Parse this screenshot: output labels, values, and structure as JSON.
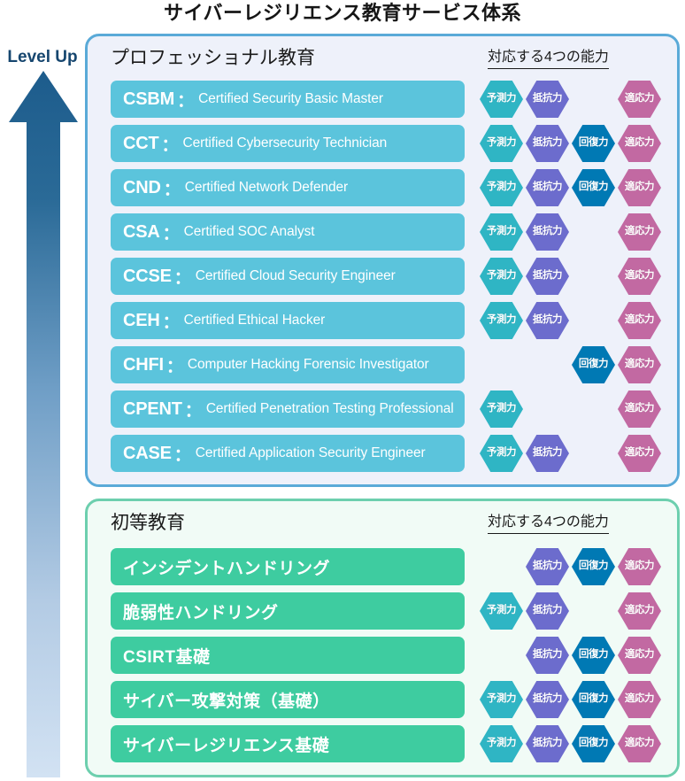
{
  "title": "サイバーレジリエンス教育サービス体系",
  "level_up": {
    "label": "Level Up",
    "arrow_icon": "up-arrow-icon",
    "gradient_from": "#1d5c8c",
    "gradient_to": "#cfe0f2"
  },
  "capability_legend": {
    "yosoku": {
      "key": "yosoku",
      "label": "予測力",
      "color": "#2fb5c4"
    },
    "teikou": {
      "key": "teikou",
      "label": "抵抗力",
      "color": "#6c6ccd"
    },
    "kaifuku": {
      "key": "kaifuku",
      "label": "回復力",
      "color": "#0079b4"
    },
    "tekiou": {
      "key": "tekiou",
      "label": "適応力",
      "color": "#c269a2"
    }
  },
  "panels": [
    {
      "id": "professional",
      "heading": "プロフェッショナル教育",
      "caps_heading": "対応する4つの能力",
      "border_color": "#5aaad8",
      "background_color": "#eef1fa",
      "bar_color": "#5bc4dc",
      "rows": [
        {
          "code": "CSBM",
          "colon": "：",
          "name": "Certified Security Basic Master",
          "capabilities": [
            "yosoku",
            "teikou",
            null,
            "tekiou"
          ]
        },
        {
          "code": "CCT",
          "colon": "：",
          "name": "Certified Cybersecurity Technician",
          "capabilities": [
            "yosoku",
            "teikou",
            "kaifuku",
            "tekiou"
          ]
        },
        {
          "code": "CND",
          "colon": "：",
          "name": "Certified Network Defender",
          "capabilities": [
            "yosoku",
            "teikou",
            "kaifuku",
            "tekiou"
          ]
        },
        {
          "code": "CSA",
          "colon": "：",
          "name": "Certified SOC Analyst",
          "capabilities": [
            "yosoku",
            "teikou",
            null,
            "tekiou"
          ]
        },
        {
          "code": "CCSE",
          "colon": "：",
          "name": "Certified Cloud Security Engineer",
          "capabilities": [
            "yosoku",
            "teikou",
            null,
            "tekiou"
          ]
        },
        {
          "code": "CEH",
          "colon": "：",
          "name": "Certified Ethical Hacker",
          "capabilities": [
            "yosoku",
            "teikou",
            null,
            "tekiou"
          ]
        },
        {
          "code": "CHFI",
          "colon": "：",
          "name": "Computer Hacking Forensic Investigator",
          "capabilities": [
            null,
            null,
            "kaifuku",
            "tekiou"
          ]
        },
        {
          "code": "CPENT",
          "colon": "：",
          "name": "Certified Penetration Testing Professional",
          "capabilities": [
            "yosoku",
            null,
            null,
            "tekiou"
          ]
        },
        {
          "code": "CASE",
          "colon": "：",
          "name": "Certified Application Security Engineer",
          "capabilities": [
            "yosoku",
            "teikou",
            null,
            "tekiou"
          ]
        }
      ]
    },
    {
      "id": "elementary",
      "heading": "初等教育",
      "caps_heading": "対応する4つの能力",
      "border_color": "#6dcfae",
      "background_color": "#f1fbf6",
      "bar_color": "#3ecca0",
      "rows": [
        {
          "code": "",
          "colon": "",
          "name": "インシデントハンドリング",
          "capabilities": [
            null,
            "teikou",
            "kaifuku",
            "tekiou"
          ]
        },
        {
          "code": "",
          "colon": "",
          "name": "脆弱性ハンドリング",
          "capabilities": [
            "yosoku",
            "teikou",
            null,
            "tekiou"
          ]
        },
        {
          "code": "",
          "colon": "",
          "name": "CSIRT基礎",
          "capabilities": [
            null,
            "teikou",
            "kaifuku",
            "tekiou"
          ]
        },
        {
          "code": "",
          "colon": "",
          "name": "サイバー攻撃対策（基礎）",
          "capabilities": [
            "yosoku",
            "teikou",
            "kaifuku",
            "tekiou"
          ]
        },
        {
          "code": "",
          "colon": "",
          "name": "サイバーレジリエンス基礎",
          "capabilities": [
            "yosoku",
            "teikou",
            "kaifuku",
            "tekiou"
          ]
        }
      ]
    }
  ]
}
